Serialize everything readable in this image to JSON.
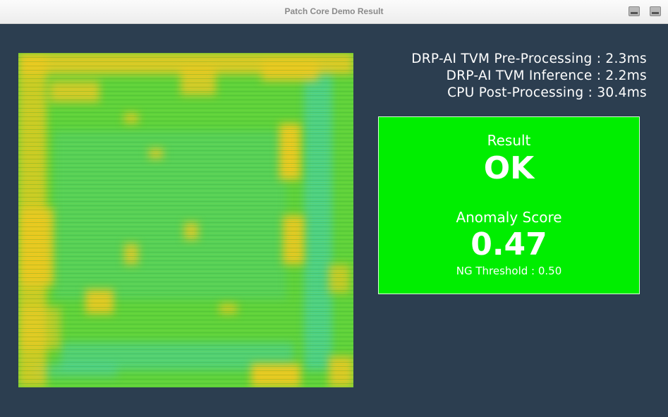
{
  "window": {
    "title": "Patch Core Demo Result"
  },
  "timing": {
    "pre_processing": "DRP-AI TVM Pre-Processing : 2.3ms",
    "inference": "DRP-AI TVM Inference : 2.2ms",
    "post_processing": "CPU Post-Processing : 30.4ms"
  },
  "result": {
    "label": "Result",
    "value": "OK",
    "score_label": "Anomaly Score",
    "score_value": "0.47",
    "threshold": "NG Threshold : 0.50"
  },
  "colors": {
    "background": "#2c3e50",
    "result_ok": "#00ee00",
    "heat_low": "#3ccfc0",
    "heat_mid": "#5fd23a",
    "heat_high": "#f2c81e"
  },
  "icons": {
    "window_button_1": "minimize-icon",
    "window_button_2": "maximize-icon"
  }
}
